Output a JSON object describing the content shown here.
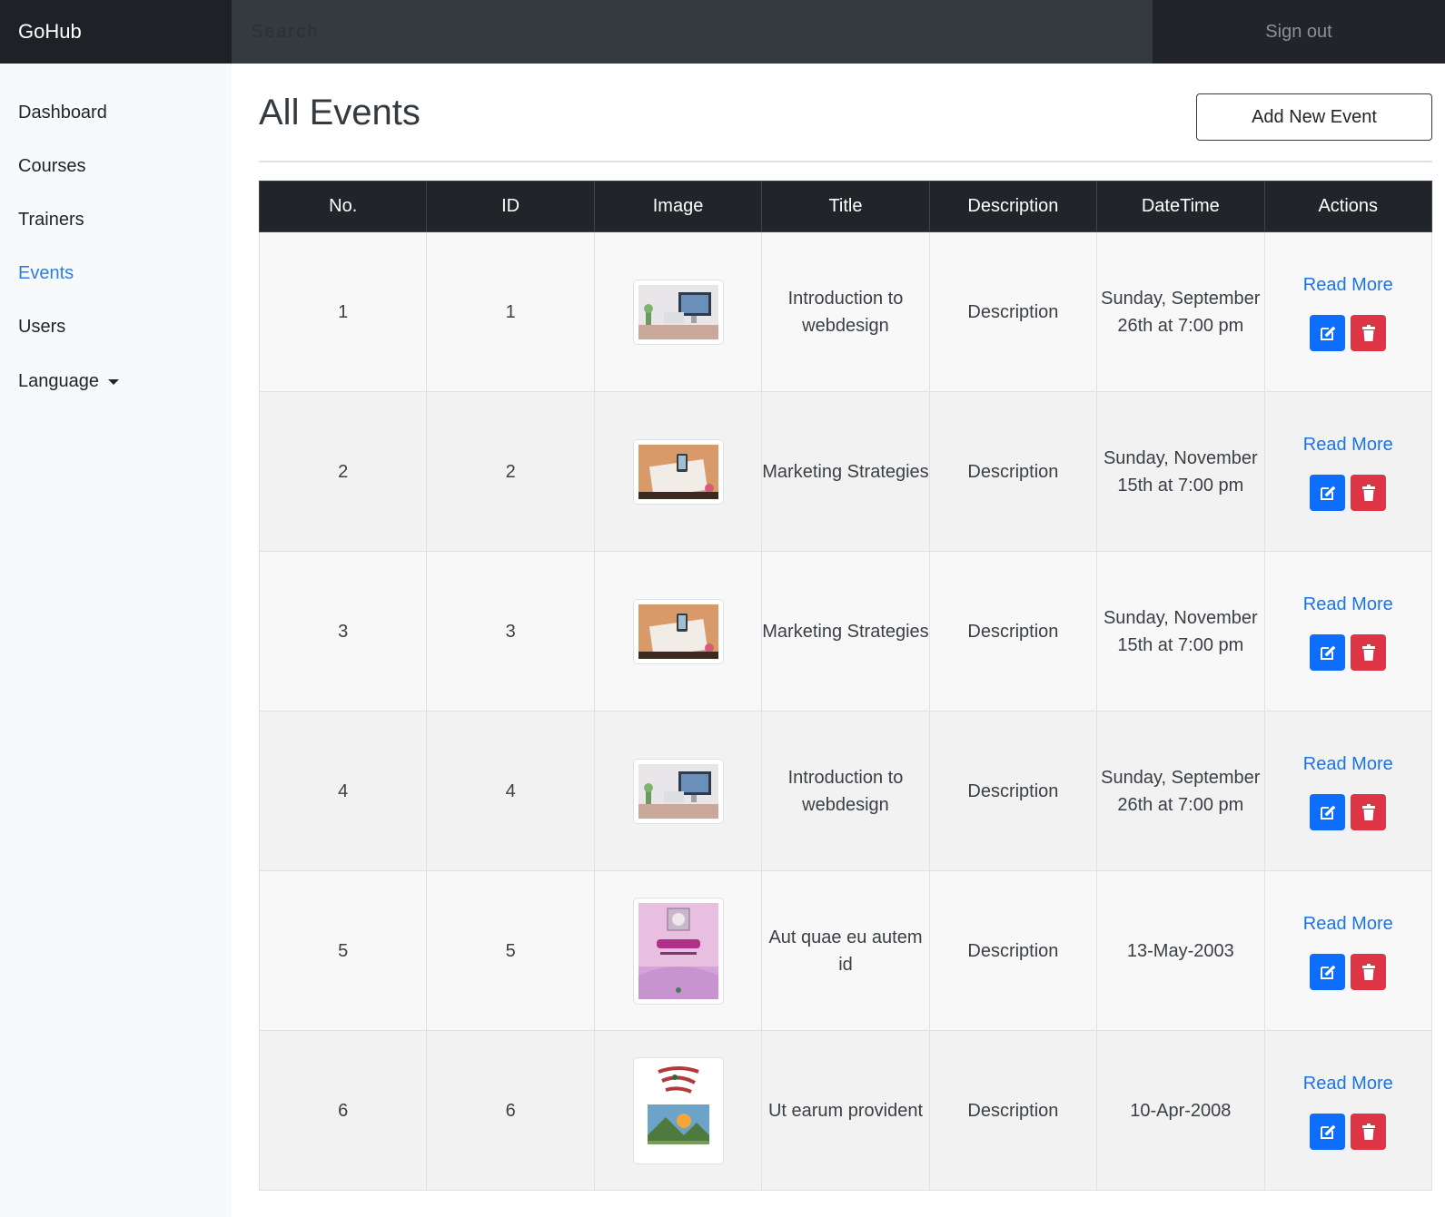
{
  "app": {
    "brand": "GoHub"
  },
  "header": {
    "search_placeholder": "Search",
    "sign_out": "Sign out"
  },
  "sidebar": {
    "items": [
      {
        "label": "Dashboard",
        "active": false
      },
      {
        "label": "Courses",
        "active": false
      },
      {
        "label": "Trainers",
        "active": false
      },
      {
        "label": "Events",
        "active": true
      },
      {
        "label": "Users",
        "active": false
      },
      {
        "label": "Language",
        "active": false,
        "dropdown": true
      }
    ]
  },
  "main": {
    "title": "All Events",
    "add_button": "Add New Event",
    "table": {
      "columns": [
        "No.",
        "ID",
        "Image",
        "Title",
        "Description",
        "DateTime",
        "Actions"
      ],
      "rows": [
        {
          "no": "1",
          "id": "1",
          "image": "desk-computer",
          "title": "Introduction to webdesign",
          "description": "Description",
          "datetime": "Sunday, September 26th at 7:00 pm",
          "read_more": "Read More"
        },
        {
          "no": "2",
          "id": "2",
          "image": "desk-phone",
          "title": "Marketing Strategies",
          "description": "Description",
          "datetime": "Sunday, November 15th at 7:00 pm",
          "read_more": "Read More"
        },
        {
          "no": "3",
          "id": "3",
          "image": "desk-phone",
          "title": "Marketing Strategies",
          "description": "Description",
          "datetime": "Sunday, November 15th at 7:00 pm",
          "read_more": "Read More"
        },
        {
          "no": "4",
          "id": "4",
          "image": "desk-computer",
          "title": "Introduction to webdesign",
          "description": "Description",
          "datetime": "Sunday, September 26th at 7:00 pm",
          "read_more": "Read More"
        },
        {
          "no": "5",
          "id": "5",
          "image": "book-cover-pink",
          "title": "Aut quae eu autem id",
          "description": "Description",
          "datetime": "13-May-2003",
          "read_more": "Read More"
        },
        {
          "no": "6",
          "id": "6",
          "image": "book-cover-landscape",
          "title": "Ut earum provident",
          "description": "Description",
          "datetime": "10-Apr-2008",
          "read_more": "Read More"
        }
      ]
    }
  },
  "colors": {
    "link": "#1a73e8",
    "edit": "#0d6efd",
    "delete": "#dc3545",
    "navbar": "#212529"
  },
  "icons": {
    "edit": "edit-icon",
    "delete": "trash-icon",
    "dropdown": "caret-down-icon"
  }
}
